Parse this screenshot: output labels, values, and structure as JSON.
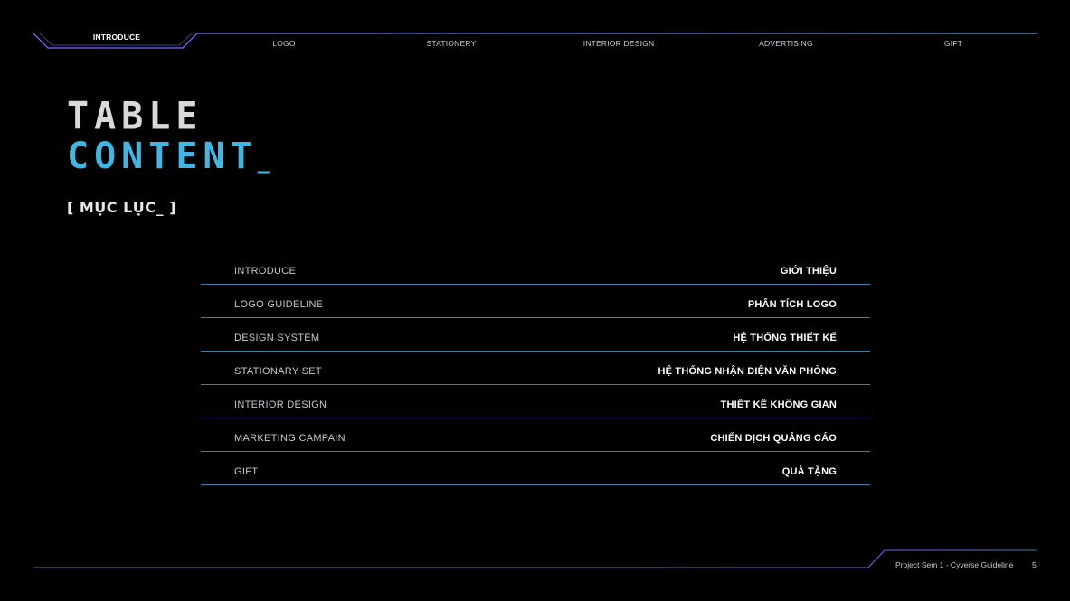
{
  "nav": {
    "items": [
      {
        "label": "INTRODUCE",
        "active": true
      },
      {
        "label": "LOGO",
        "active": false
      },
      {
        "label": "STATIONERY",
        "active": false
      },
      {
        "label": "INTERIOR DESIGN",
        "active": false
      },
      {
        "label": "ADVERTISING",
        "active": false
      },
      {
        "label": "GIFT",
        "active": false
      }
    ]
  },
  "heading": {
    "line1": "TABLE",
    "line2": "CONTENT",
    "cursor": "_",
    "subtitle": "[ MỤC LỤC_ ]"
  },
  "toc": {
    "rows": [
      {
        "en": "INTRODUCE",
        "vi": "GIỚI THIỆU"
      },
      {
        "en": "LOGO GUIDELINE",
        "vi": "PHÂN TÍCH LOGO"
      },
      {
        "en": "DESIGN SYSTEM",
        "vi": "HỆ THỐNG THIẾT KẾ"
      },
      {
        "en": "STATIONARY SET",
        "vi": "HỆ THỐNG NHẬN DIỆN VĂN PHÒNG"
      },
      {
        "en": "INTERIOR DESIGN",
        "vi": "THIẾT KẾ KHÔNG GIAN"
      },
      {
        "en": "MARKETING CAMPAIN",
        "vi": "CHIẾN DỊCH QUẢNG CÁO"
      },
      {
        "en": "GIFT",
        "vi": "QUÀ TẶNG"
      }
    ]
  },
  "footer": {
    "text": "Project Sem 1 - Cyverse Guideline",
    "page": "5"
  },
  "colors": {
    "background": "#000000",
    "accent_cyan": "#3fb6e3",
    "accent_purple": "#7a5cff",
    "line_blue": "#3d7fa8"
  }
}
